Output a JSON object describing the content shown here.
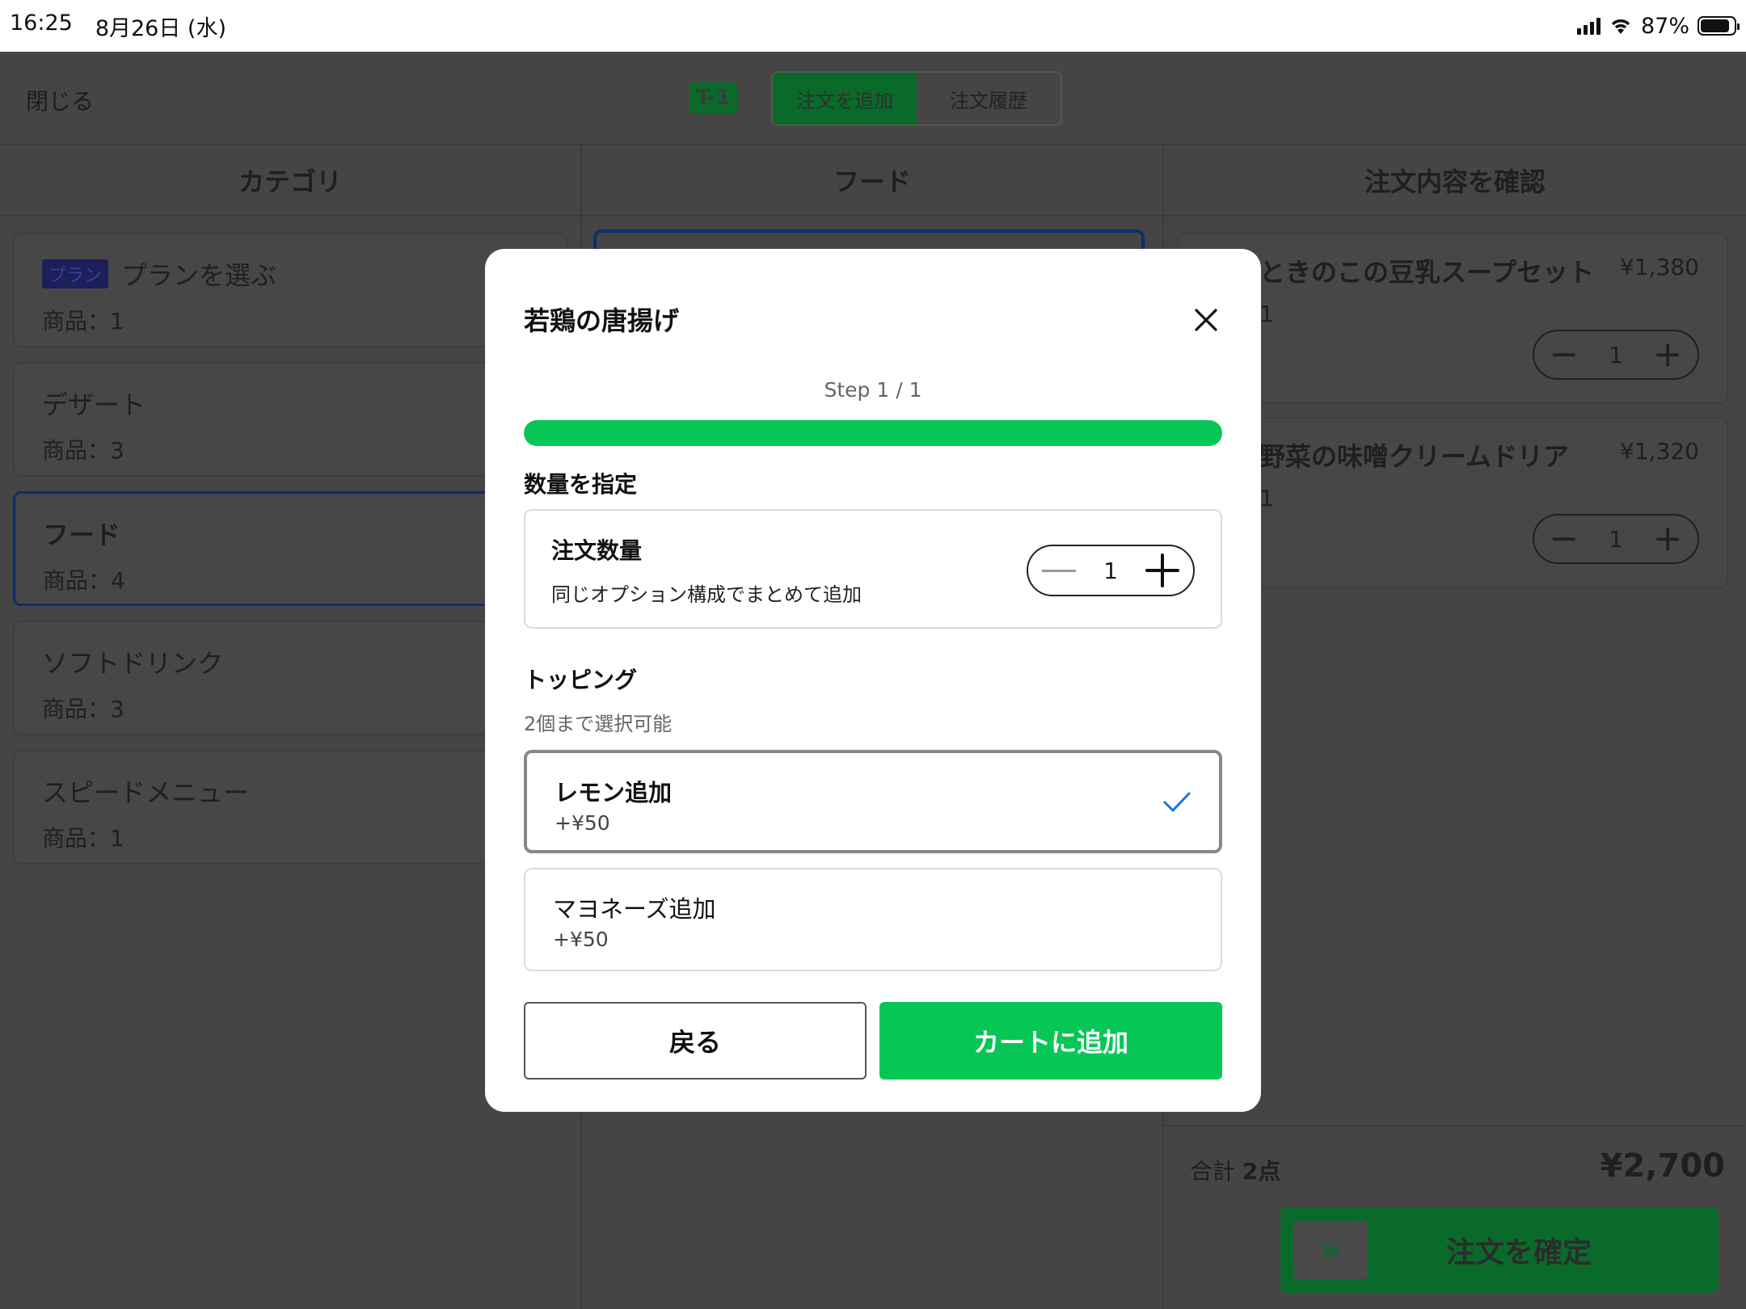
{
  "status_bar": {
    "time": "16:25",
    "date": "8月26日 (水)",
    "battery": "87%"
  },
  "header": {
    "close_label": "閉じる",
    "table_badge": "T-1",
    "tabs": [
      {
        "label": "注文を追加",
        "active": true
      },
      {
        "label": "注文履歴",
        "active": false
      }
    ]
  },
  "columns": {
    "category_title": "カテゴリ",
    "food_title": "フード",
    "cart_title": "注文内容を確認"
  },
  "categories": [
    {
      "badge": "プラン",
      "name": "プランを選ぶ",
      "count": "商品：1"
    },
    {
      "name": "デザート",
      "count": "商品：3"
    },
    {
      "name": "フード",
      "count": "商品：4",
      "selected": true
    },
    {
      "name": "ソフトドリンク",
      "count": "商品：3"
    },
    {
      "name": "スピードメニュー",
      "count": "商品：1"
    }
  ],
  "cart": {
    "items": [
      {
        "name": "ときのこの豆乳スープセット",
        "price": "¥1,380",
        "qty_text": "1",
        "stepper_value": "1"
      },
      {
        "name": "野菜の味噌クリームドリア",
        "price": "¥1,320",
        "qty_text": "1",
        "stepper_value": "1"
      }
    ],
    "total_label": "合計",
    "total_count": "2点",
    "total_price": "¥2,700",
    "confirm_label": "注文を確定",
    "confirm_icon": "»"
  },
  "modal": {
    "title": "若鶏の唐揚げ",
    "step_label": "Step 1 / 1",
    "progress": 1.0,
    "quantity_section": "数量を指定",
    "quantity_title": "注文数量",
    "quantity_desc": "同じオプション構成でまとめて追加",
    "quantity_value": "1",
    "topping_section": "トッピング",
    "topping_sub": "2個まで選択可能",
    "options": [
      {
        "name": "レモン追加",
        "price": "+¥50",
        "selected": true
      },
      {
        "name": "マヨネーズ追加",
        "price": "+¥50",
        "selected": false
      }
    ],
    "back_label": "戻る",
    "add_label": "カートに追加"
  },
  "colors": {
    "accent": "#06c755",
    "check": "#1a73e8",
    "dim_background": "#454545"
  }
}
